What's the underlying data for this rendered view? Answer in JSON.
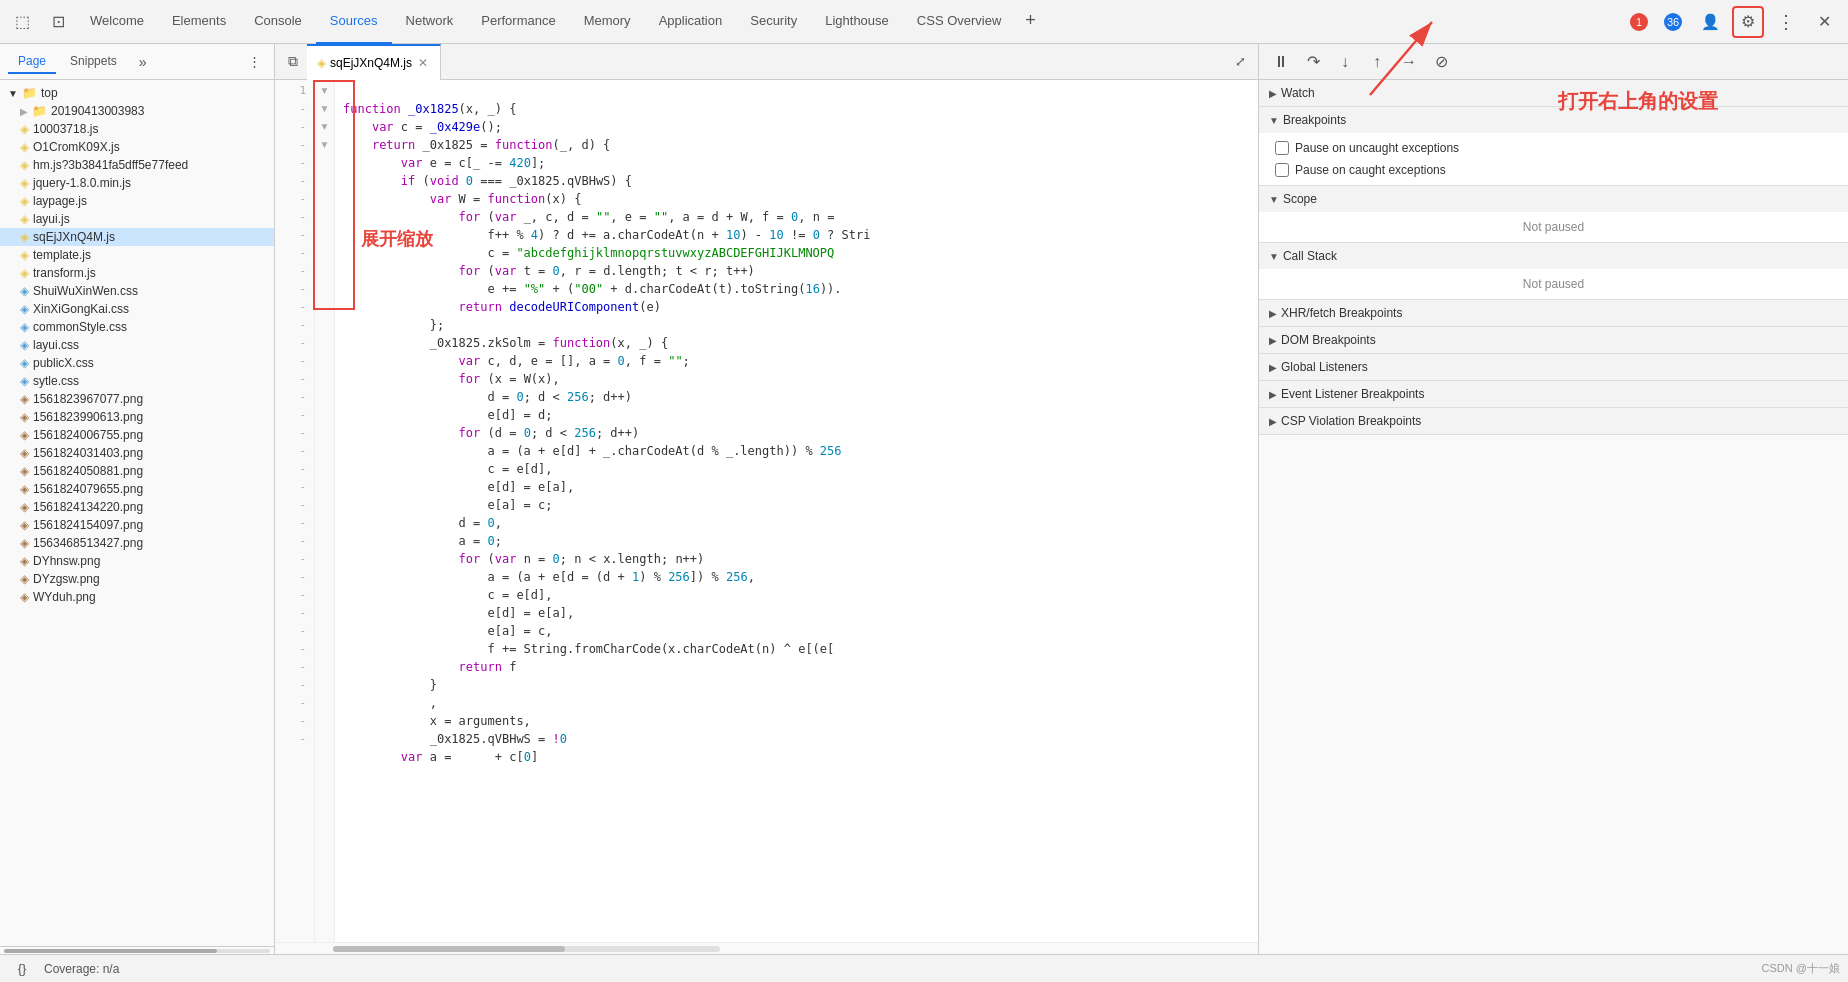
{
  "toolbar": {
    "tabs": [
      {
        "label": "Welcome",
        "id": "welcome",
        "active": false
      },
      {
        "label": "Elements",
        "id": "elements",
        "active": false
      },
      {
        "label": "Console",
        "id": "console",
        "active": false
      },
      {
        "label": "Sources",
        "id": "sources",
        "active": true
      },
      {
        "label": "Network",
        "id": "network",
        "active": false
      },
      {
        "label": "Performance",
        "id": "performance",
        "active": false
      },
      {
        "label": "Memory",
        "id": "memory",
        "active": false
      },
      {
        "label": "Application",
        "id": "application",
        "active": false
      },
      {
        "label": "Security",
        "id": "security",
        "active": false
      },
      {
        "label": "Lighthouse",
        "id": "lighthouse",
        "active": false
      },
      {
        "label": "CSS Overview",
        "id": "css-overview",
        "active": false
      }
    ],
    "error_count": "1",
    "warning_count": "36",
    "plus_label": "+",
    "more_label": "⋮",
    "close_label": "✕"
  },
  "left_panel": {
    "tabs": [
      "Page",
      "Snippets"
    ],
    "active_tab": "Page",
    "more_label": "»",
    "kebab_label": "⋮",
    "tree": {
      "root_label": "top",
      "items": [
        {
          "label": "20190413003983",
          "type": "folder"
        },
        {
          "label": "10003718.js",
          "type": "js"
        },
        {
          "label": "O1CromK09X.js",
          "type": "js"
        },
        {
          "label": "hm.js?3b3841fa5dff5e77feed",
          "type": "js"
        },
        {
          "label": "jquery-1.8.0.min.js",
          "type": "js"
        },
        {
          "label": "laypage.js",
          "type": "js"
        },
        {
          "label": "layui.js",
          "type": "js"
        },
        {
          "label": "sqEjJXnQ4M.js",
          "type": "js",
          "selected": true
        },
        {
          "label": "template.js",
          "type": "js"
        },
        {
          "label": "transform.js",
          "type": "js"
        },
        {
          "label": "ShuiWuXinWen.css",
          "type": "css"
        },
        {
          "label": "XinXiGongKai.css",
          "type": "css"
        },
        {
          "label": "commonStyle.css",
          "type": "css"
        },
        {
          "label": "layui.css",
          "type": "css"
        },
        {
          "label": "publicX.css",
          "type": "css"
        },
        {
          "label": "sytle.css",
          "type": "css"
        },
        {
          "label": "1561823967077.png",
          "type": "img"
        },
        {
          "label": "1561823990613.png",
          "type": "img"
        },
        {
          "label": "1561824006755.png",
          "type": "img"
        },
        {
          "label": "1561824031403.png",
          "type": "img"
        },
        {
          "label": "1561824050881.png",
          "type": "img"
        },
        {
          "label": "1561824079655.png",
          "type": "img"
        },
        {
          "label": "1561824134220.png",
          "type": "img"
        },
        {
          "label": "1561824154097.png",
          "type": "img"
        },
        {
          "label": "1563468513427.png",
          "type": "img"
        },
        {
          "label": "DYhnsw.png",
          "type": "img"
        },
        {
          "label": "DYzgsw.png",
          "type": "img"
        },
        {
          "label": "WYduh.png",
          "type": "img"
        }
      ]
    }
  },
  "code_panel": {
    "toggle_label": "⧉",
    "active_file": "sqEjJXnQ4M.js",
    "close_label": "✕",
    "expand_label": "⤢",
    "coverage_label": "Coverage: n/a"
  },
  "right_panel": {
    "debug_toolbar": {
      "pause_label": "⏸",
      "step_over_label": "↷",
      "step_into_label": "↓",
      "step_out_label": "↑",
      "step_label": "→",
      "deactivate_label": "⊘"
    },
    "sections": [
      {
        "id": "watch",
        "label": "Watch",
        "collapsed": true,
        "arrow": "▶"
      },
      {
        "id": "breakpoints",
        "label": "Breakpoints",
        "collapsed": false,
        "arrow": "▼",
        "checkboxes": [
          {
            "label": "Pause on uncaught exceptions",
            "checked": false
          },
          {
            "label": "Pause on caught exceptions",
            "checked": false
          }
        ]
      },
      {
        "id": "scope",
        "label": "Scope",
        "collapsed": false,
        "arrow": "▼",
        "body_text": "Not paused"
      },
      {
        "id": "call-stack",
        "label": "Call Stack",
        "collapsed": false,
        "arrow": "▼",
        "body_text": "Not paused"
      },
      {
        "id": "xhr-fetch-breakpoints",
        "label": "XHR/fetch Breakpoints",
        "collapsed": true,
        "arrow": "▶"
      },
      {
        "id": "dom-breakpoints",
        "label": "DOM Breakpoints",
        "collapsed": true,
        "arrow": "▶"
      },
      {
        "id": "global-listeners",
        "label": "Global Listeners",
        "collapsed": true,
        "arrow": "▶"
      },
      {
        "id": "event-listener-breakpoints",
        "label": "Event Listener Breakpoints",
        "collapsed": true,
        "arrow": "▶"
      },
      {
        "id": "csp-violation-breakpoints",
        "label": "CSP Violation Breakpoints",
        "collapsed": true,
        "arrow": "▶"
      }
    ]
  },
  "annotations": {
    "expand_label": "展开缩放",
    "settings_label": "打开右上角的设置"
  },
  "code_lines": [
    {
      "num": "1",
      "arrow": "▼",
      "text": "function _0x1825(x, _) {"
    },
    {
      "num": "",
      "arrow": " ",
      "text": "    var c = _0x429e();"
    },
    {
      "num": "",
      "arrow": " ",
      "text": "    return _0x1825 = function(_, d) {"
    },
    {
      "num": "",
      "arrow": "▼",
      "text": "        var e = c[_ -= 420];"
    },
    {
      "num": "",
      "arrow": " ",
      "text": "        if (void 0 === _0x1825.qVBHwS) {"
    },
    {
      "num": "",
      "arrow": "▼",
      "text": "            var W = function(x) {"
    },
    {
      "num": "",
      "arrow": " ",
      "text": "                for (var _, c, d = \"\", e = \"\", a = d + W, f = 0, n ="
    },
    {
      "num": "",
      "arrow": " ",
      "text": "                    f++ % 4) ? d += a.charCodeAt(n + 10) - 10 != 0 ? Stri"
    },
    {
      "num": "",
      "arrow": " ",
      "text": "                    c = \"abcdefghijklmnopqrstuvwxyzABCDEFGHIJKLMNOPQ"
    },
    {
      "num": "",
      "arrow": " ",
      "text": "                for (var t = 0, r = d.length; t < r; t++)"
    },
    {
      "num": "",
      "arrow": " ",
      "text": "                    e += \"%\" + (\"00\" + d.charCodeAt(t).toString(16))."
    },
    {
      "num": "",
      "arrow": " ",
      "text": "                return decodeURIComponent(e)"
    },
    {
      "num": "",
      "arrow": " ",
      "text": "            };"
    },
    {
      "num": "",
      "arrow": " ",
      "text": "            _0x1825.zkSolm = function(x, _) {"
    },
    {
      "num": "",
      "arrow": " ",
      "text": "                var c, d, e = [], a = 0, f = \"\";"
    },
    {
      "num": "",
      "arrow": " ",
      "text": "                for (x = W(x),"
    },
    {
      "num": "",
      "arrow": " ",
      "text": "                    d = 0; d < 256; d++)"
    },
    {
      "num": "",
      "arrow": " ",
      "text": "                    e[d] = d;"
    },
    {
      "num": "",
      "arrow": " ",
      "text": "                for (d = 0; d < 256; d++)"
    },
    {
      "num": "",
      "arrow": " ",
      "text": "                    a = (a + e[d] + _.charCodeAt(d % _.length)) % 256"
    },
    {
      "num": "",
      "arrow": " ",
      "text": "                    c = e[d],"
    },
    {
      "num": "",
      "arrow": " ",
      "text": "                    e[d] = e[a],"
    },
    {
      "num": "",
      "arrow": " ",
      "text": "                    e[a] = c;"
    },
    {
      "num": "",
      "arrow": " ",
      "text": "                d = 0,"
    },
    {
      "num": "",
      "arrow": " ",
      "text": "                a = 0;"
    },
    {
      "num": "",
      "arrow": " ",
      "text": "                for (var n = 0; n < x.length; n++)"
    },
    {
      "num": "",
      "arrow": " ",
      "text": "                    a = (a + e[d = (d + 1) % 256]) % 256,"
    },
    {
      "num": "",
      "arrow": " ",
      "text": "                    c = e[d],"
    },
    {
      "num": "",
      "arrow": " ",
      "text": "                    e[d] = e[a],"
    },
    {
      "num": "",
      "arrow": " ",
      "text": "                    e[a] = c,"
    },
    {
      "num": "",
      "arrow": " ",
      "text": "                    f += String.fromCharCode(x.charCodeAt(n) ^ e[(e["
    },
    {
      "num": "",
      "arrow": " ",
      "text": "                return f"
    },
    {
      "num": "",
      "arrow": " ",
      "text": "            }"
    },
    {
      "num": "",
      "arrow": " ",
      "text": "            ,"
    },
    {
      "num": "",
      "arrow": " ",
      "text": "            x = arguments,"
    },
    {
      "num": "",
      "arrow": "▼",
      "text": "            _0x1825.qVBHwS = !0"
    },
    {
      "num": "",
      "arrow": " ",
      "text": "        var a =      + c[0]"
    }
  ],
  "csdn_watermark": "CSDN @十一娘"
}
